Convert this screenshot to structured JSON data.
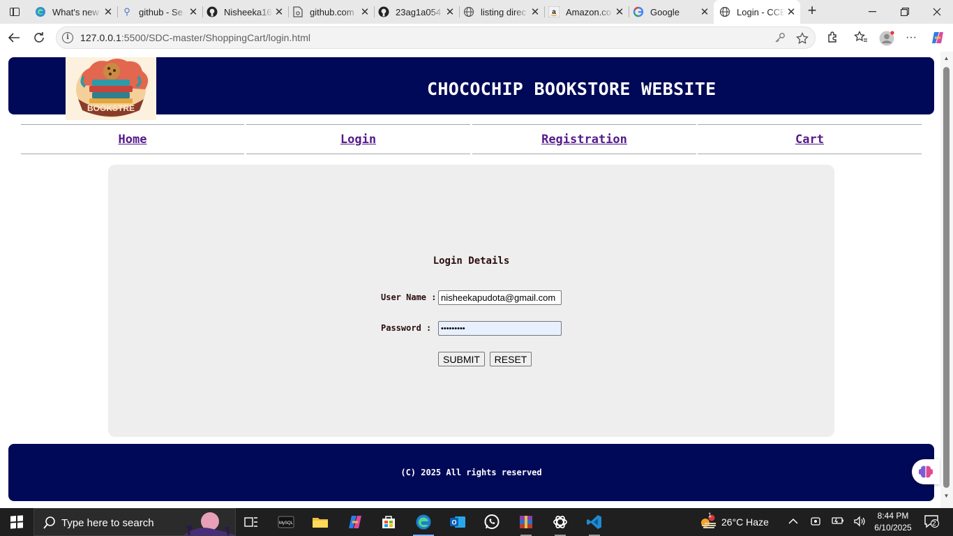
{
  "browser": {
    "tabs": [
      {
        "title": "What's new",
        "icon": "edge-icon"
      },
      {
        "title": "github - Se",
        "icon": "search-icon"
      },
      {
        "title": "Nisheeka16",
        "icon": "github-icon"
      },
      {
        "title": "github.com",
        "icon": "page-icon"
      },
      {
        "title": "23ag1a054",
        "icon": "github-icon"
      },
      {
        "title": "listing direc",
        "icon": "globe-icon"
      },
      {
        "title": "Amazon.co",
        "icon": "amazon-icon"
      },
      {
        "title": "Google",
        "icon": "google-icon"
      },
      {
        "title": "Login - CCB",
        "icon": "globe-icon",
        "active": true
      }
    ],
    "new_tab": "+",
    "url_host": "127.0.0.1",
    "url_rest": ":5500/SDC-master/ShoppingCart/login.html"
  },
  "page": {
    "logo_text": "BOOKSTRE",
    "site_title": "CHOCOCHIP BOOKSTORE WEBSITE",
    "nav": [
      {
        "label": "Home"
      },
      {
        "label": "Login"
      },
      {
        "label": "Registration"
      },
      {
        "label": "Cart"
      }
    ],
    "login": {
      "heading": "Login Details",
      "username_label": "User Name :",
      "username_value": "nisheekapudota@gmail.com",
      "password_label": "Password :",
      "password_value": "•••••••••",
      "submit_label": "SUBMIT",
      "reset_label": "RESET"
    },
    "footer_text": "(C) 2025 All rights reserved"
  },
  "taskbar": {
    "search_placeholder": "Type here to search",
    "weather_badge": "1",
    "weather": "26°C  Haze",
    "time": "8:44 PM",
    "date": "6/10/2025",
    "notification_count": "2"
  },
  "colors": {
    "header_bg": "#000957",
    "panel_bg": "#eeeeee",
    "link": "#551a8b",
    "text_dark": "#2b0d0d"
  }
}
